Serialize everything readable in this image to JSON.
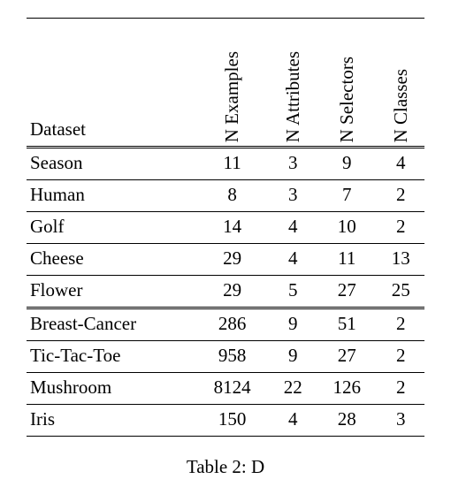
{
  "chart_data": {
    "type": "table",
    "columns": [
      "Dataset",
      "N Examples",
      "N Attributes",
      "N Selectors",
      "N Classes"
    ],
    "groups": [
      {
        "rows": [
          {
            "dataset": "Season",
            "n_examples": 11,
            "n_attributes": 3,
            "n_selectors": 9,
            "n_classes": 4
          },
          {
            "dataset": "Human",
            "n_examples": 8,
            "n_attributes": 3,
            "n_selectors": 7,
            "n_classes": 2
          },
          {
            "dataset": "Golf",
            "n_examples": 14,
            "n_attributes": 4,
            "n_selectors": 10,
            "n_classes": 2
          },
          {
            "dataset": "Cheese",
            "n_examples": 29,
            "n_attributes": 4,
            "n_selectors": 11,
            "n_classes": 13
          },
          {
            "dataset": "Flower",
            "n_examples": 29,
            "n_attributes": 5,
            "n_selectors": 27,
            "n_classes": 25
          }
        ]
      },
      {
        "rows": [
          {
            "dataset": "Breast-Cancer",
            "n_examples": 286,
            "n_attributes": 9,
            "n_selectors": 51,
            "n_classes": 2
          },
          {
            "dataset": "Tic-Tac-Toe",
            "n_examples": 958,
            "n_attributes": 9,
            "n_selectors": 27,
            "n_classes": 2
          },
          {
            "dataset": "Mushroom",
            "n_examples": 8124,
            "n_attributes": 22,
            "n_selectors": 126,
            "n_classes": 2
          },
          {
            "dataset": "Iris",
            "n_examples": 150,
            "n_attributes": 4,
            "n_selectors": 28,
            "n_classes": 3
          }
        ]
      }
    ]
  },
  "headers": {
    "dataset": "Dataset",
    "n_examples": "N Examples",
    "n_attributes": "N Attributes",
    "n_selectors": "N Selectors",
    "n_classes": "N Classes"
  },
  "caption_prefix": "Table 2: D"
}
